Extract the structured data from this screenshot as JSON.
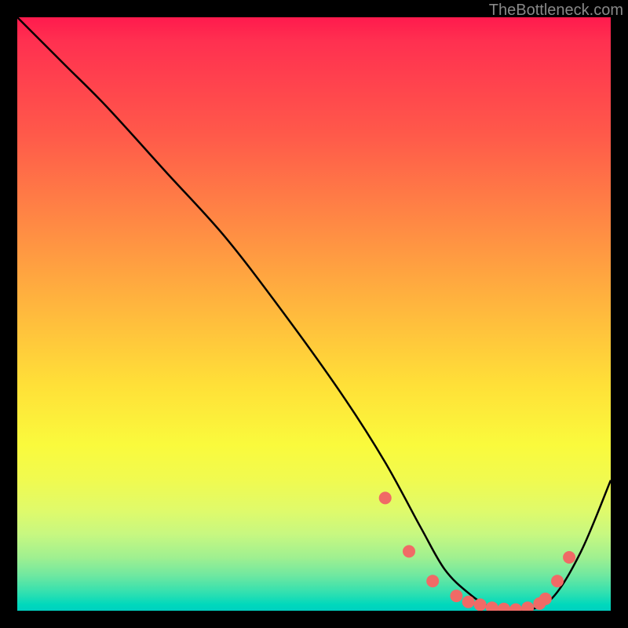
{
  "watermark": "TheBottleneck.com",
  "chart_data": {
    "type": "line",
    "title": "",
    "xlabel": "",
    "ylabel": "",
    "xlim": [
      0,
      100
    ],
    "ylim": [
      0,
      100
    ],
    "x": [
      0,
      8,
      15,
      25,
      35,
      45,
      55,
      62,
      68,
      72,
      76,
      80,
      85,
      90,
      95,
      100
    ],
    "values": [
      100,
      92,
      85,
      74,
      63,
      50,
      36,
      25,
      14,
      7,
      3,
      0.5,
      0,
      2,
      10,
      22
    ],
    "markers": {
      "x": [
        62,
        66,
        70,
        74,
        76,
        78,
        80,
        82,
        84,
        86,
        88,
        89,
        91,
        93
      ],
      "y": [
        19,
        10,
        5,
        2.5,
        1.5,
        1,
        0.5,
        0.3,
        0.2,
        0.5,
        1.2,
        2,
        5,
        9
      ]
    },
    "background_gradient": {
      "top": "#ff1a4d",
      "middle": "#ffe038",
      "bottom": "#00d0c0"
    }
  }
}
